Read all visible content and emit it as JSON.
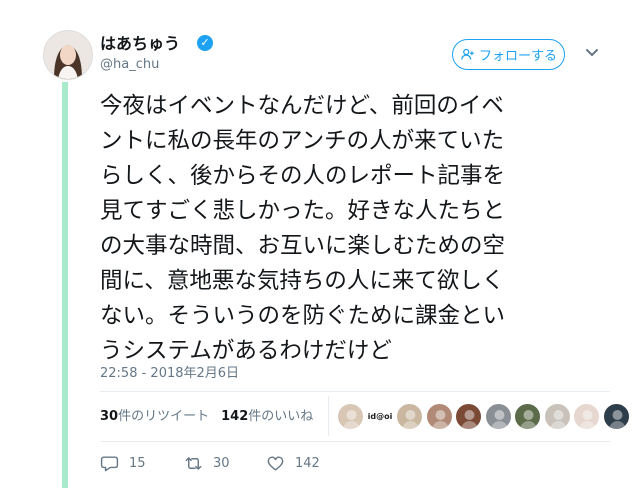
{
  "author": {
    "name": "はあちゅう",
    "handle": "@ha_chu",
    "verified": true
  },
  "follow_button": {
    "label": "フォローする",
    "icon": "add-user-icon"
  },
  "tweet": {
    "text": "今夜はイベントなんだけど、前回のイベ\nントに私の長年のアンチの人が来ていた\nらしく、後からその人のレポート記事を\n見てすごく悲しかった。好きな人たちと\nの大事な時間、お互いに楽しむための空\n間に、意地悪な気持ちの人に来て欲しく\nない。そういうのを防ぐために課金とい\nうシステムがあるわけだけど",
    "timestamp": "22:58 - 2018年2月6日"
  },
  "stats": {
    "retweets_count": "30",
    "retweets_label": "件のリツイート",
    "likes_count": "142",
    "likes_label": "件のいいね",
    "liker_avatars": [
      {
        "name": "liker-avatar-1",
        "text": ""
      },
      {
        "name": "liker-avatar-2",
        "text": "id@oi"
      },
      {
        "name": "liker-avatar-3",
        "text": ""
      },
      {
        "name": "liker-avatar-4",
        "text": ""
      },
      {
        "name": "liker-avatar-5",
        "text": ""
      },
      {
        "name": "liker-avatar-6",
        "text": ""
      },
      {
        "name": "liker-avatar-7",
        "text": ""
      },
      {
        "name": "liker-avatar-8",
        "text": ""
      },
      {
        "name": "liker-avatar-9",
        "text": ""
      },
      {
        "name": "liker-avatar-10",
        "text": ""
      }
    ]
  },
  "actions": {
    "replies": "15",
    "retweets": "30",
    "likes": "142"
  },
  "colors": {
    "accent": "#1da1f2",
    "thread_line": "#a8eacb",
    "muted_text": "#657786",
    "divider": "#e6ecf0"
  }
}
